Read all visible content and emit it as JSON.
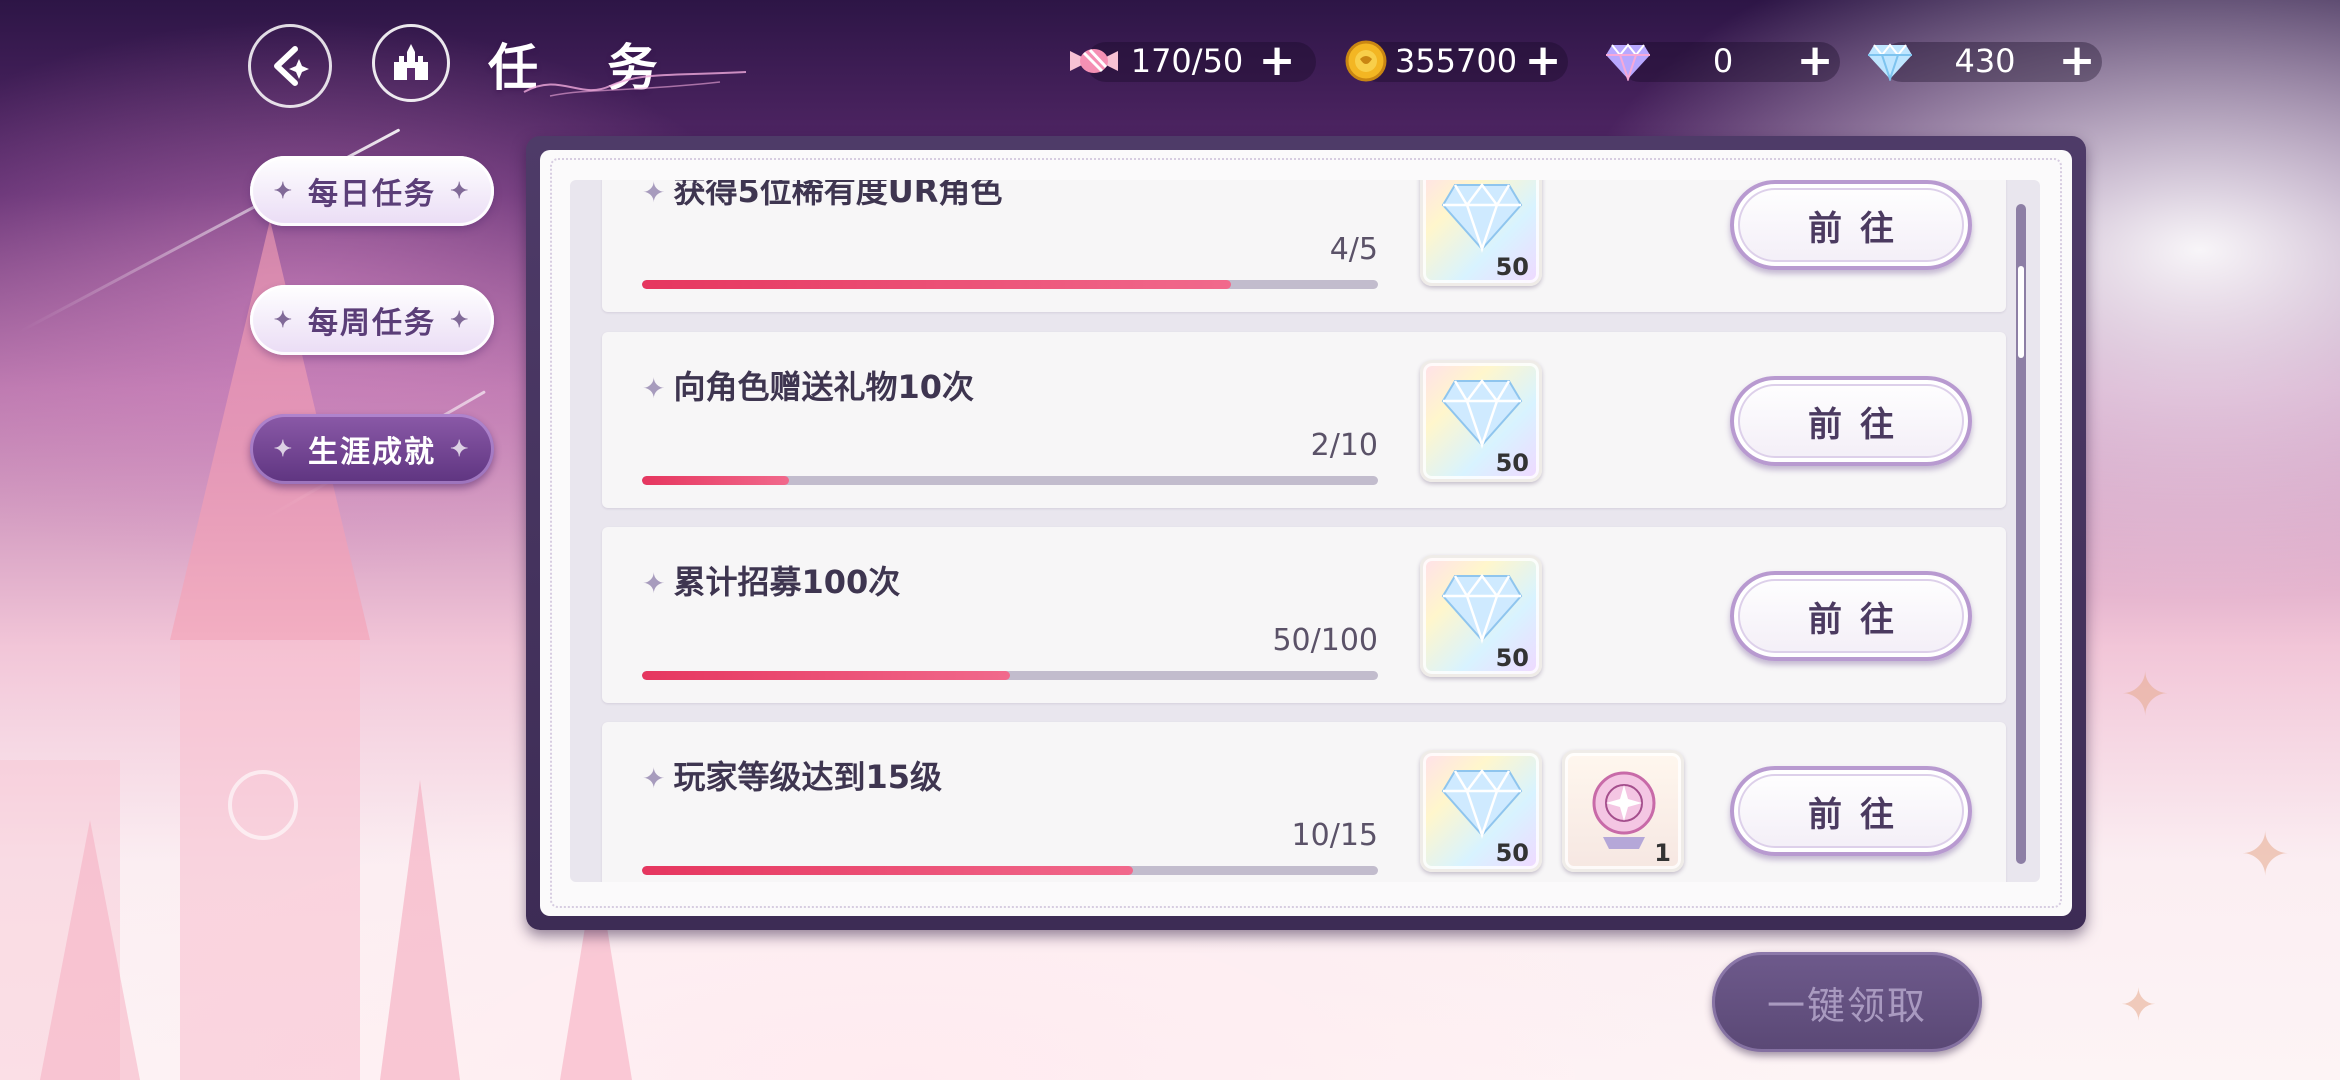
{
  "header": {
    "title": "任 务"
  },
  "resources": [
    {
      "icon": "candy-icon",
      "value": "170/50",
      "plus": "+"
    },
    {
      "icon": "gold-coin-icon",
      "value": "355700",
      "plus": "+"
    },
    {
      "icon": "rainbow-diamond-icon",
      "value": "0",
      "plus": "+"
    },
    {
      "icon": "blue-diamond-icon",
      "value": "430",
      "plus": "+"
    }
  ],
  "sidebar": {
    "tabs": [
      {
        "label": "每日任务",
        "active": false
      },
      {
        "label": "每周任务",
        "active": false
      },
      {
        "label": "生涯成就",
        "active": true
      }
    ]
  },
  "tasks": [
    {
      "title": "获得5位稀有度UR角色",
      "progress_text": "4/5",
      "progress": 0.8,
      "rewards": [
        {
          "type": "diamond",
          "count": "50"
        }
      ],
      "button": "前往"
    },
    {
      "title": "向角色赠送礼物10次",
      "progress_text": "2/10",
      "progress": 0.2,
      "rewards": [
        {
          "type": "diamond",
          "count": "50"
        }
      ],
      "button": "前往"
    },
    {
      "title": "累计招募100次",
      "progress_text": "50/100",
      "progress": 0.5,
      "rewards": [
        {
          "type": "diamond",
          "count": "50"
        }
      ],
      "button": "前往"
    },
    {
      "title": "玩家等级达到15级",
      "progress_text": "10/15",
      "progress": 0.667,
      "rewards": [
        {
          "type": "diamond",
          "count": "50"
        },
        {
          "type": "crystal-orb",
          "count": "1"
        }
      ],
      "button": "前往"
    }
  ],
  "claim_all": "一键领取",
  "colors": {
    "progress_fill": "#e6365f",
    "progress_track": "#c2bccd",
    "panel_frame": "#4e3b68",
    "active_tab": "#6f4592"
  }
}
